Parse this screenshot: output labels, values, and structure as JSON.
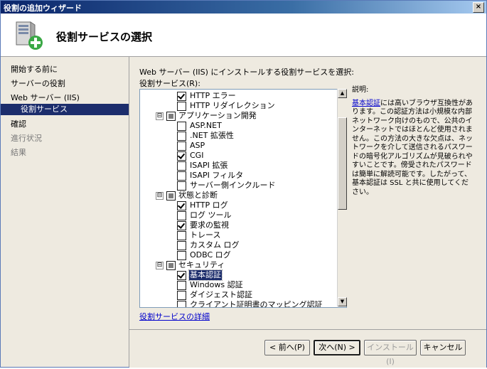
{
  "window": {
    "title": "役割の追加ウィザード",
    "close_label": "×"
  },
  "header": {
    "title": "役割サービスの選択",
    "icon": "server-add-icon"
  },
  "nav": {
    "items": [
      {
        "label": "開始する前に"
      },
      {
        "label": "サーバーの役割"
      },
      {
        "label": "Web サーバー (IIS)"
      },
      {
        "label": "役割サービス"
      },
      {
        "label": "確認"
      },
      {
        "label": "進行状況"
      },
      {
        "label": "結果"
      }
    ]
  },
  "main": {
    "instruction": "Web サーバー (IIS) にインストールする役割サービスを選択:",
    "tree_label": "役割サービス(R):",
    "details_link": "役割サービスの詳細"
  },
  "tree": {
    "rows": [
      {
        "label": "HTTP エラー",
        "checked": true,
        "level": 2
      },
      {
        "label": "HTTP リダイレクション",
        "checked": false,
        "level": 2
      },
      {
        "label": "アプリケーション開発",
        "checked": "partial",
        "level": 1,
        "expander": "⊟"
      },
      {
        "label": "ASP.NET",
        "checked": false,
        "level": 2
      },
      {
        "label": ".NET 拡張性",
        "checked": false,
        "level": 2
      },
      {
        "label": "ASP",
        "checked": false,
        "level": 2
      },
      {
        "label": "CGI",
        "checked": true,
        "level": 2
      },
      {
        "label": "ISAPI 拡張",
        "checked": false,
        "level": 2
      },
      {
        "label": "ISAPI フィルタ",
        "checked": false,
        "level": 2
      },
      {
        "label": "サーバー側インクルード",
        "checked": false,
        "level": 2
      },
      {
        "label": "状態と診断",
        "checked": "partial",
        "level": 1,
        "expander": "⊟"
      },
      {
        "label": "HTTP ログ",
        "checked": true,
        "level": 2
      },
      {
        "label": "ログ ツール",
        "checked": false,
        "level": 2
      },
      {
        "label": "要求の監視",
        "checked": true,
        "level": 2
      },
      {
        "label": "トレース",
        "checked": false,
        "level": 2
      },
      {
        "label": "カスタム ログ",
        "checked": false,
        "level": 2
      },
      {
        "label": "ODBC ログ",
        "checked": false,
        "level": 2
      },
      {
        "label": "セキュリティ",
        "checked": "partial",
        "level": 1,
        "expander": "⊟"
      },
      {
        "label": "基本認証",
        "checked": true,
        "level": 2,
        "highlighted": true
      },
      {
        "label": "Windows 認証",
        "checked": false,
        "level": 2
      },
      {
        "label": "ダイジェスト認証",
        "checked": false,
        "level": 2
      },
      {
        "label": "クライアント証明書のマッピング認証",
        "checked": false,
        "level": 2
      }
    ]
  },
  "description": {
    "heading": "説明:",
    "link": "基本認証",
    "text": "には高いブラウザ互換性があります。この認証方法は小規模な内部ネットワーク向けのもので、公共のインターネットではほとんど使用されません。この方法の大きな欠点は、ネットワークを介して送信されるパスワードの暗号化アルゴリズムが見破られやすいことです。傍受されたパスワードは簡単に解読可能です。したがって、基本認証は SSL と共に使用してください。"
  },
  "buttons": {
    "back": "< 前へ(P)",
    "next": "次へ(N) >",
    "install": "インストール(I)",
    "cancel": "キャンセル"
  }
}
